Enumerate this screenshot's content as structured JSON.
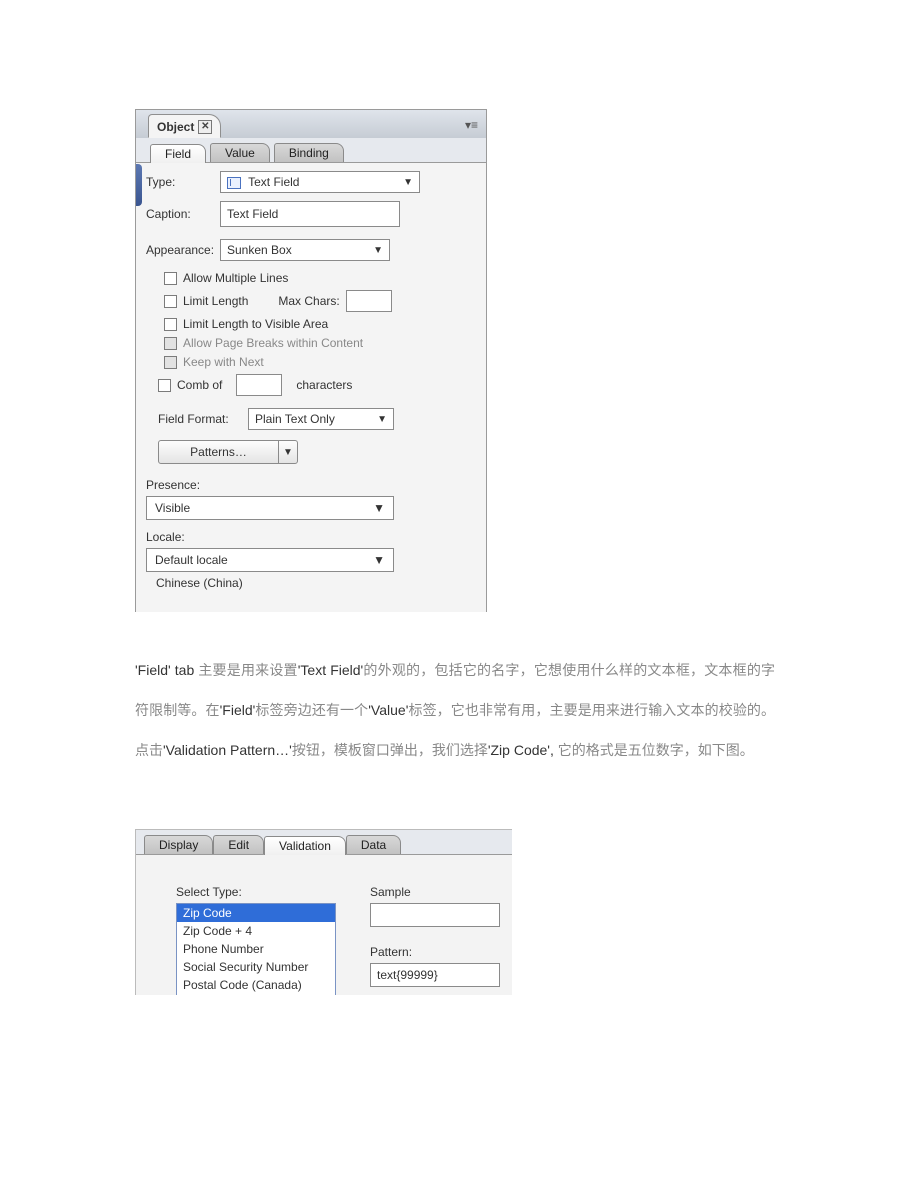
{
  "panel1": {
    "title": "Object",
    "tabs": [
      "Field",
      "Value",
      "Binding"
    ],
    "active_tab": 0,
    "type_label": "Type:",
    "type_value": "Text Field",
    "caption_label": "Caption:",
    "caption_value": "Text Field",
    "appearance_label": "Appearance:",
    "appearance_value": "Sunken Box",
    "allow_multiple": "Allow Multiple Lines",
    "limit_length": "Limit Length",
    "max_chars_label": "Max Chars:",
    "limit_visible": "Limit Length to Visible Area",
    "allow_page_breaks": "Allow Page Breaks within Content",
    "keep_with_next": "Keep with Next",
    "comb_of": "Comb of",
    "characters": "characters",
    "field_format_label": "Field Format:",
    "field_format_value": "Plain Text Only",
    "patterns": "Patterns…",
    "presence_label": "Presence:",
    "presence_value": "Visible",
    "locale_label": "Locale:",
    "locale_value": "Default locale",
    "locale_readout": "Chinese (China)"
  },
  "paragraph": {
    "seg1_latin": "'Field' tab ",
    "seg2_cn": "主要是用来设置",
    "seg3_latin": "'Text Field'",
    "seg4_cn": "的外观的，包括它的名字，它想使用什么样的文本框，文本框的字符限制等。在",
    "seg5_latin": "'Field'",
    "seg6_cn": "标签旁边还有一个",
    "seg7_latin": "'Value'",
    "seg8_cn": "标签，它也非常有用，主要是用来进行输入文本的校验的。点击",
    "seg9_latin": "'Validation Pattern…'",
    "seg10_cn": "按钮，模板窗口弹出，我们选择",
    "seg11_latin": "'Zip Code', ",
    "seg12_cn": "它的格式是五位数字，如下图。"
  },
  "panel2": {
    "tabs": [
      "Display",
      "Edit",
      "Validation",
      "Data"
    ],
    "active_tab": 2,
    "select_type_label": "Select Type:",
    "items": [
      "Zip Code",
      "Zip Code + 4",
      "Phone Number",
      "Social Security Number",
      "Postal Code (Canada)"
    ],
    "selected_index": 0,
    "sample_label": "Sample",
    "sample_value": "",
    "pattern_label": "Pattern:",
    "pattern_value": "text{99999}"
  }
}
